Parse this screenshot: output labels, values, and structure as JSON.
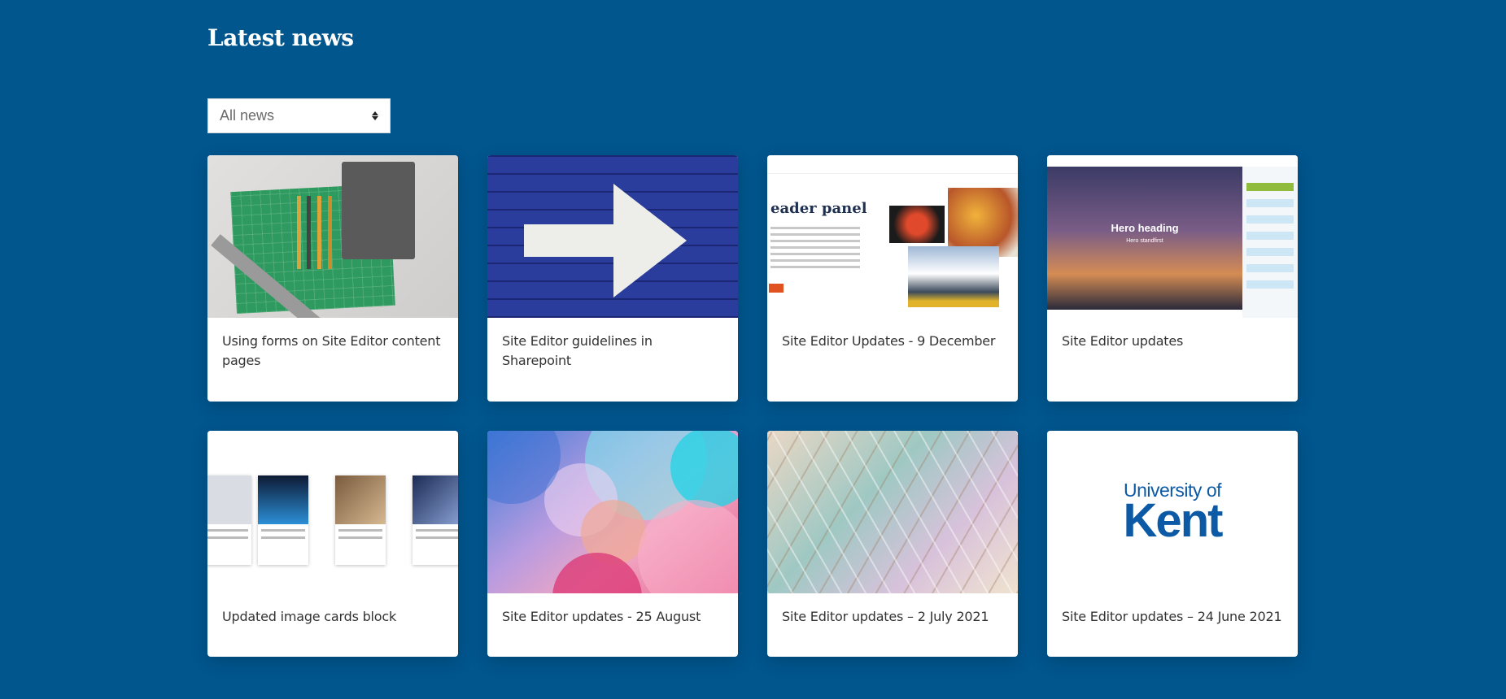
{
  "page": {
    "title": "Latest news"
  },
  "filter": {
    "selected": "All news"
  },
  "cards": [
    {
      "title": "Using forms on Site Editor content pages",
      "image": "desk-stationery-photo"
    },
    {
      "title": "Site Editor guidelines in Sharepoint",
      "image": "arrow-on-brick-wall-photo"
    },
    {
      "title": "Site Editor Updates - 9 December",
      "image": "header-panel-screenshot",
      "image_text": "eader panel"
    },
    {
      "title": "Site Editor updates",
      "image": "hero-panel-screenshot",
      "image_text": "Hero heading",
      "image_subtext": "Hero standfirst"
    },
    {
      "title": "Updated image cards block",
      "image": "image-cards-screenshot"
    },
    {
      "title": "Site Editor updates - 25 August",
      "image": "abstract-bubbles-photo"
    },
    {
      "title": "Site Editor updates – 2 July 2021",
      "image": "stained-glass-pattern"
    },
    {
      "title": "Site Editor updates – 24 June 2021",
      "image": "university-logo",
      "logo_line1": "University of",
      "logo_line2": "Kent"
    }
  ],
  "colors": {
    "background": "#01568e",
    "card": "#ffffff",
    "logo": "#0c5aa6"
  }
}
